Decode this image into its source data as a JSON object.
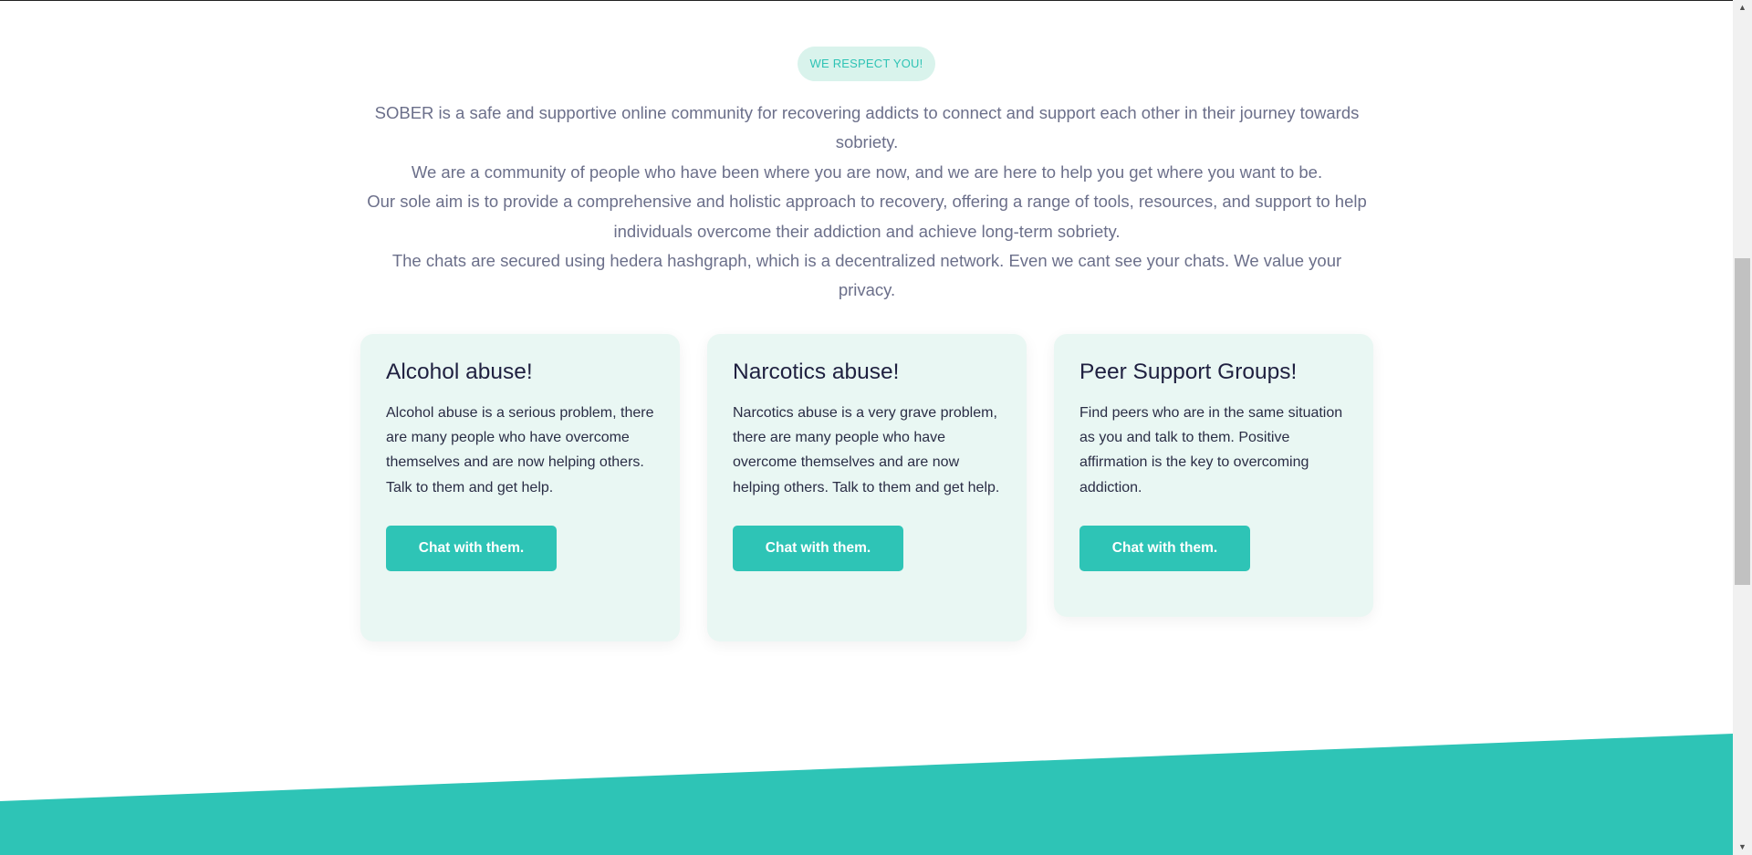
{
  "badge": {
    "label": "WE RESPECT YOU!"
  },
  "intro": {
    "paragraphs": [
      "SOBER is a safe and supportive online community for recovering addicts to connect and support each other in their journey towards sobriety.",
      "We are a community of people who have been where you are now, and we are here to help you get where you want to be.",
      "Our sole aim is to provide a comprehensive and holistic approach to recovery, offering a range of tools, resources, and support to help individuals overcome their addiction and achieve long-term sobriety.",
      "The chats are secured using hedera hashgraph, which is a decentralized network. Even we cant see your chats. We value your privacy."
    ]
  },
  "cards": [
    {
      "title": "Alcohol abuse!",
      "description": "Alcohol abuse is a serious problem, there are many people who have overcome themselves and are now helping others. Talk to them and get help.",
      "button_label": "Chat with them."
    },
    {
      "title": "Narcotics abuse!",
      "description": "Narcotics abuse is a very grave problem, there are many people who have overcome themselves and are now helping others. Talk to them and get help.",
      "button_label": "Chat with them."
    },
    {
      "title": "Peer Support Groups!",
      "description": "Find peers who are in the same situation as you and talk to them. Positive affirmation is the key to overcoming addiction.",
      "button_label": "Chat with them."
    }
  ],
  "colors": {
    "accent": "#2ec4b6",
    "card_bg": "#e9f7f3",
    "badge_bg": "#d9f3ec",
    "intro_text": "#6b6f8a",
    "heading_text": "#1f2040"
  },
  "scrollbar": {
    "up_icon": "chevron-up-icon",
    "down_icon": "chevron-down-icon"
  }
}
